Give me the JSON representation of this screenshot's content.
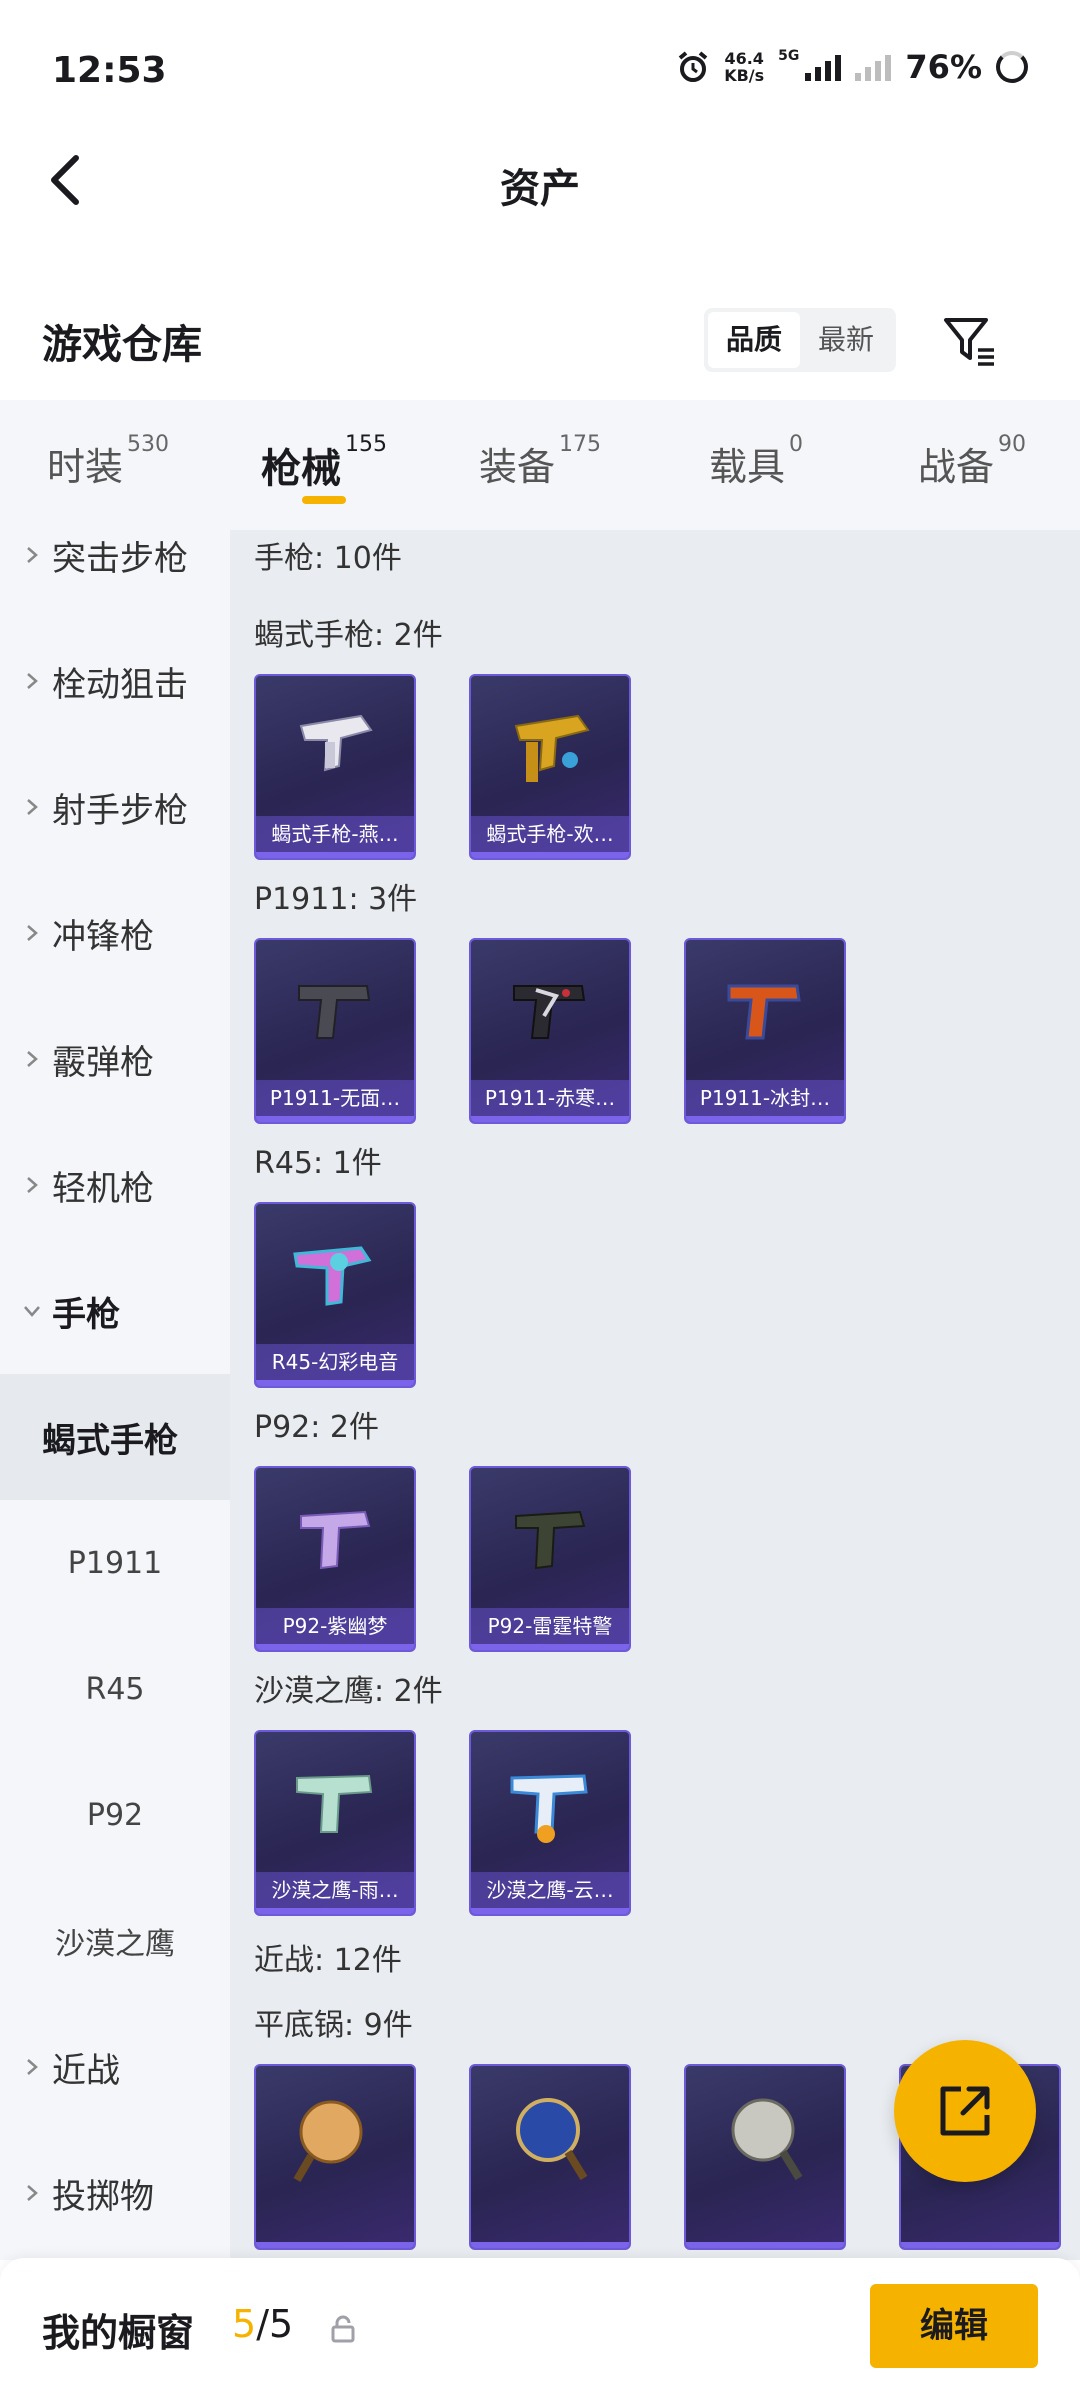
{
  "status": {
    "time": "12:53",
    "net_speed_value": "46.4",
    "net_speed_unit": "KB/s",
    "network": "5G",
    "battery": "76%"
  },
  "titlebar": {
    "title": "资产"
  },
  "warehouse": {
    "title": "游戏仓库",
    "sort_options": [
      "品质",
      "最新"
    ],
    "sort_active": "品质"
  },
  "tabs": [
    {
      "label": "时装",
      "count": "530"
    },
    {
      "label": "枪械",
      "count": "155",
      "active": true
    },
    {
      "label": "装备",
      "count": "175"
    },
    {
      "label": "载具",
      "count": "0"
    },
    {
      "label": "战备",
      "count": "90"
    }
  ],
  "sidebar": {
    "items": [
      "突击步枪",
      "栓动狙击",
      "射手步枪",
      "冲锋枪",
      "霰弹枪",
      "轻机枪"
    ],
    "open_item": "手枪",
    "subitems": [
      "蝎式手枪",
      "P1911",
      "R45",
      "P92",
      "沙漠之鹰"
    ],
    "active_subitem": "蝎式手枪",
    "items_after": [
      "近战",
      "投掷物"
    ]
  },
  "content": {
    "group_pistol": "手枪: 10件",
    "scorpion": {
      "header": "蝎式手枪: 2件",
      "cards": [
        "蝎式手枪-燕…",
        "蝎式手枪-欢…"
      ]
    },
    "p1911": {
      "header": "P1911: 3件",
      "cards": [
        "P1911-无面…",
        "P1911-赤寒…",
        "P1911-冰封…"
      ]
    },
    "r45": {
      "header": "R45: 1件",
      "cards": [
        "R45-幻彩电音"
      ]
    },
    "p92": {
      "header": "P92: 2件",
      "cards": [
        "P92-紫幽梦",
        "P92-雷霆特警"
      ]
    },
    "deagle": {
      "header": "沙漠之鹰: 2件",
      "cards": [
        "沙漠之鹰-雨…",
        "沙漠之鹰-云…"
      ]
    },
    "group_melee": "近战: 12件",
    "pan": {
      "header": "平底锅: 9件"
    }
  },
  "bottom": {
    "showcase_label": "我的橱窗",
    "showcase_current": "5",
    "showcase_total": "/5",
    "edit_label": "编辑"
  },
  "colors": {
    "accent": "#f5b300",
    "card_bg": "#2a2552",
    "card_border": "#6c5ad8"
  }
}
